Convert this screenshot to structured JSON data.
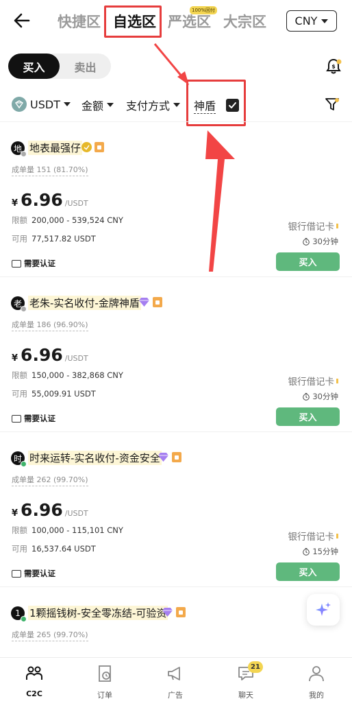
{
  "header": {
    "zones": [
      "快捷区",
      "自选区",
      "严选区",
      "大宗区"
    ],
    "active_zone": "自选区",
    "strict_tag": "100%回付",
    "currency": "CNY"
  },
  "toggle": {
    "buy": "买入",
    "sell": "卖出"
  },
  "filters": {
    "coin": "USDT",
    "amount": "金额",
    "payment": "支付方式",
    "shendun": "神盾"
  },
  "labels": {
    "limit": "限额",
    "available": "可用",
    "kyc": "需要认证",
    "buy": "买入",
    "currency_symbol": "¥",
    "unit": "/USDT"
  },
  "ads": [
    {
      "avatar": "地",
      "name": "地表最强仔",
      "stats": "成单量 151 (81.70%)",
      "price": "6.96",
      "limit": "200,000 - 539,524 CNY",
      "available": "77,517.82 USDT",
      "payment": "银行借记卡",
      "time": "30分钟",
      "status_color": "#aaaaaa"
    },
    {
      "avatar": "老",
      "name": "老朱-实名收付-金牌神盾",
      "stats": "成单量 186 (96.90%)",
      "price": "6.96",
      "limit": "150,000 - 382,868 CNY",
      "available": "55,009.91 USDT",
      "payment": "银行借记卡",
      "time": "30分钟",
      "status_color": "#aaaaaa"
    },
    {
      "avatar": "时",
      "name": "时来运转-实名收付-资金安全",
      "stats": "成单量 262 (99.70%)",
      "price": "6.96",
      "limit": "100,000 - 115,101 CNY",
      "available": "16,537.64 USDT",
      "payment": "银行借记卡",
      "time": "15分钟",
      "status_color": "#3fb36b"
    },
    {
      "avatar": "1",
      "name": "1颗摇钱树-安全零冻结-可验资",
      "stats": "成单量 265 (99.70%)",
      "status_color": "#3fb36b"
    }
  ],
  "nav": [
    {
      "label": "C2C",
      "icon": "c2c-icon"
    },
    {
      "label": "订单",
      "icon": "order-icon"
    },
    {
      "label": "广告",
      "icon": "megaphone-icon"
    },
    {
      "label": "聊天",
      "icon": "chat-icon"
    },
    {
      "label": "我的",
      "icon": "profile-icon"
    }
  ],
  "chat_badge": "21",
  "colors": {
    "buy_green": "#5fb87d",
    "highlight_red": "#e63d3d",
    "badge_yellow": "#f3d552"
  }
}
